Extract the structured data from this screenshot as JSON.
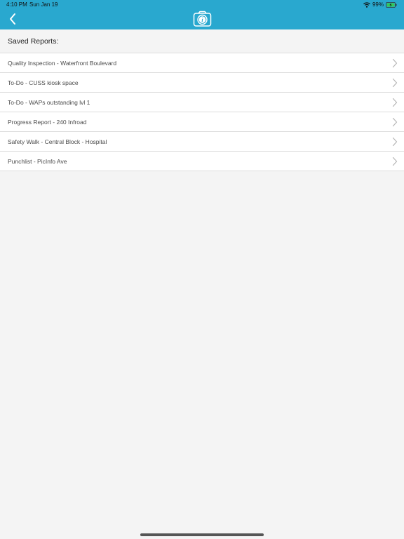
{
  "status_bar": {
    "time": "4:10 PM",
    "date": "Sun Jan 19",
    "battery": "99%",
    "icons": [
      "wifi-icon",
      "battery-charging-icon"
    ]
  },
  "nav_bar": {
    "back_icon": "chevron-left-icon",
    "logo_icon": "camera-info-icon",
    "colors": {
      "background": "#29a8cf",
      "icon": "#ffffff"
    }
  },
  "section": {
    "title": "Saved Reports:"
  },
  "reports": [
    {
      "label": "Quality Inspection - Waterfront Boulevard"
    },
    {
      "label": "To-Do - CUSS kiosk space"
    },
    {
      "label": "To-Do - WAPs outstanding lvl 1"
    },
    {
      "label": "Progress Report - 240 Infroad"
    },
    {
      "label": "Safety Walk - Central Block - Hospital"
    },
    {
      "label": "Punchlist - PicInfo Ave"
    }
  ]
}
